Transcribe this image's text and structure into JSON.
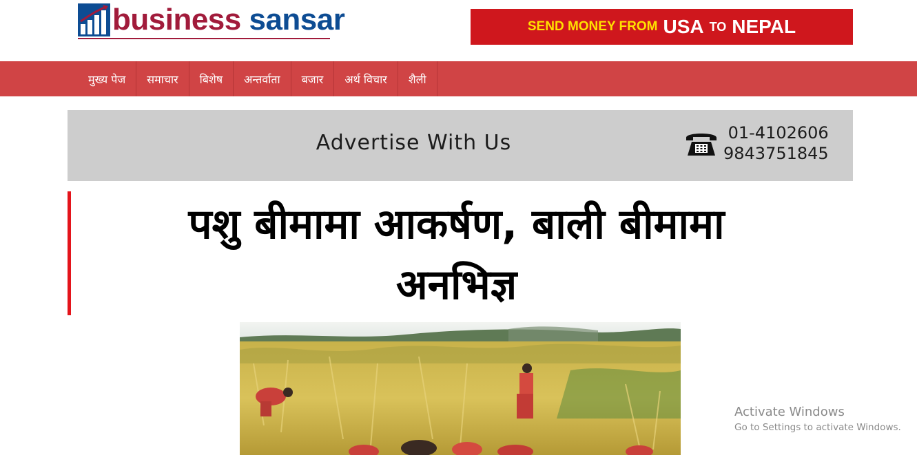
{
  "logo": {
    "word1": "business",
    "word2": "sansar"
  },
  "top_ad": {
    "part1": "SEND MONEY FROM",
    "part2": "USA",
    "part3": "TO",
    "part4": "NEPAL",
    "bg_color": "#cf171d",
    "accent_color": "#ffe100"
  },
  "nav": {
    "items": [
      {
        "label": "मुख्य पेज"
      },
      {
        "label": "समाचार"
      },
      {
        "label": "बिशेष"
      },
      {
        "label": "अन्तर्वाता"
      },
      {
        "label": "बजार"
      },
      {
        "label": "अर्थ विचार"
      },
      {
        "label": "शैली"
      }
    ],
    "bg_color": "#d04445"
  },
  "advertise": {
    "text": "Advertise With Us",
    "phone1": "01-4102606",
    "phone2": "9843751845",
    "icon": "telephone-icon"
  },
  "article": {
    "headline_line1": "पशु बीमामा आकर्षण, बाली बीमामा",
    "headline_line2": "अनभिज्ञ",
    "image_icon": "rice-harvest-photo"
  },
  "watermark": {
    "title": "Activate Windows",
    "subtitle": "Go to Settings to activate Windows."
  }
}
